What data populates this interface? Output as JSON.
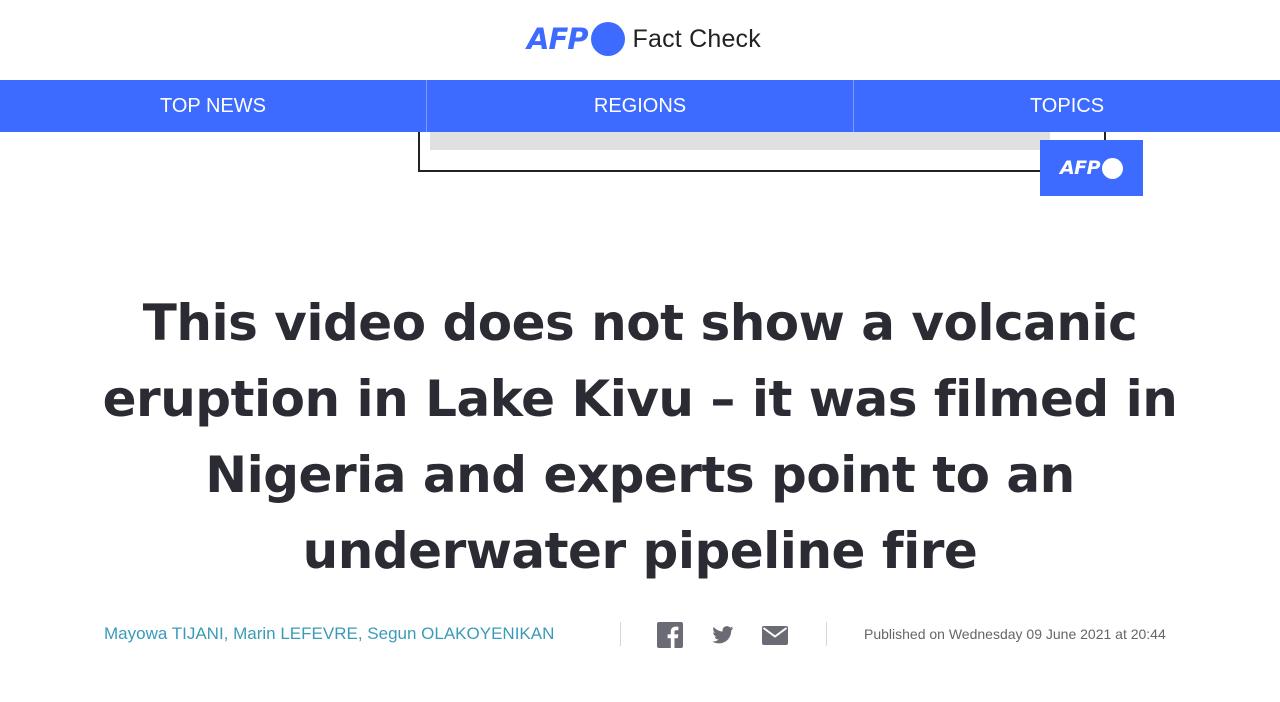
{
  "brand": {
    "logo_text": "AFP",
    "product": "Fact Check"
  },
  "nav": {
    "items": [
      {
        "label": "TOP NEWS"
      },
      {
        "label": "REGIONS"
      },
      {
        "label": "TOPICS"
      }
    ]
  },
  "media_badge": {
    "logo_text": "AFP"
  },
  "article": {
    "title": "This video does not show a volcanic eruption in Lake Kivu – it was filmed in Nigeria and experts point to an underwater pipeline fire",
    "authors": [
      {
        "name": "Mayowa TIJANI"
      },
      {
        "name": "Marin LEFEVRE"
      },
      {
        "name": "Segun OLAKOYENIKAN"
      }
    ],
    "author_separator": ", ",
    "published": "Published on Wednesday 09 June 2021 at 20:44"
  },
  "share": {
    "icons": [
      "facebook-icon",
      "twitter-icon",
      "email-icon"
    ]
  },
  "colors": {
    "brand_blue": "#3d6bff",
    "author_link": "#3a9bb8",
    "headline": "#2b2b33",
    "meta_text": "#666666"
  }
}
